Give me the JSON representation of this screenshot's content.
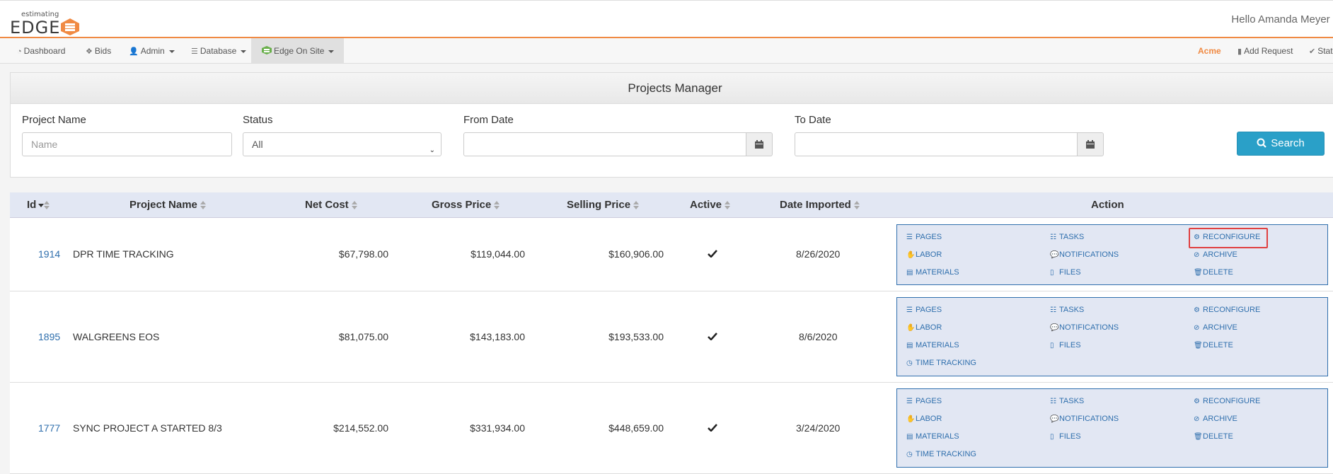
{
  "header": {
    "logo_small": "estimating",
    "logo_big": "EDGE",
    "greeting": "Hello Amanda Meyer !"
  },
  "nav": {
    "items": [
      {
        "label": "Dashboard",
        "icon": "dashboard-icon"
      },
      {
        "label": "Bids",
        "icon": "cubes-icon"
      },
      {
        "label": "Admin",
        "icon": "user-gear-icon"
      },
      {
        "label": "Database",
        "icon": "database-icon"
      },
      {
        "label": "Edge On Site",
        "icon": "edge-onsite-icon"
      }
    ],
    "right": [
      {
        "label": "Acme"
      },
      {
        "label": "Add Request",
        "icon": "clipboard-icon"
      },
      {
        "label": "Stat",
        "icon": "check-circle-icon"
      }
    ]
  },
  "panel": {
    "title": "Projects Manager",
    "filters": {
      "project_name_label": "Project Name",
      "project_name_placeholder": "Name",
      "status_label": "Status",
      "status_value": "All",
      "from_date_label": "From Date",
      "to_date_label": "To Date"
    },
    "search_label": "Search"
  },
  "table": {
    "columns": [
      "Id",
      "Project Name",
      "Net Cost",
      "Gross Price",
      "Selling Price",
      "Active",
      "Date Imported",
      "Action"
    ],
    "rows": [
      {
        "id": "1914",
        "name": "DPR TIME TRACKING",
        "net_cost": "$67,798.00",
        "gross_price": "$119,044.00",
        "selling_price": "$160,906.00",
        "active": true,
        "date_imported": "8/26/2020",
        "time_tracking": false
      },
      {
        "id": "1895",
        "name": "WALGREENS EOS",
        "net_cost": "$81,075.00",
        "gross_price": "$143,183.00",
        "selling_price": "$193,533.00",
        "active": true,
        "date_imported": "8/6/2020",
        "time_tracking": true
      },
      {
        "id": "1777",
        "name": "SYNC PROJECT A STARTED 8/3",
        "net_cost": "$214,552.00",
        "gross_price": "$331,934.00",
        "selling_price": "$448,659.00",
        "active": true,
        "date_imported": "3/24/2020",
        "time_tracking": true
      }
    ],
    "actions": {
      "pages": "PAGES",
      "tasks": "TASKS",
      "reconfigure": "RECONFIGURE",
      "labor": "LABOR",
      "notifications": "NOTIFICATIONS",
      "archive": "ARCHIVE",
      "materials": "MATERIALS",
      "files": "FILES",
      "delete": "DELETE",
      "time_tracking": "TIME TRACKING"
    }
  },
  "colors": {
    "accent": "#f08a43",
    "link": "#2f6fad",
    "search_button": "#2aa0c8",
    "highlight": "#e04040"
  }
}
